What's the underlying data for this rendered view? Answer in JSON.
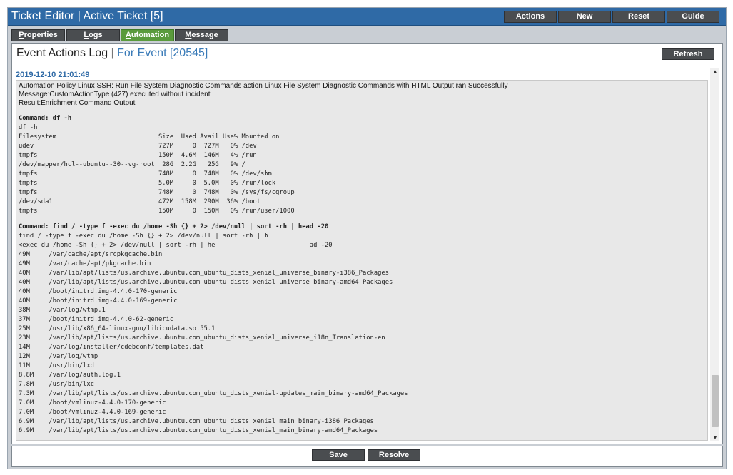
{
  "window": {
    "title": "Ticket Editor | Active Ticket [5]",
    "buttons": [
      "Actions",
      "New",
      "Reset",
      "Guide"
    ]
  },
  "tabs": [
    {
      "label": "Properties",
      "underline": "P",
      "rest": "roperties",
      "active": false
    },
    {
      "label": "Logs",
      "underline": "L",
      "rest": "ogs",
      "active": false
    },
    {
      "label": "Automation",
      "underline": "A",
      "rest": "utomation",
      "active": true
    },
    {
      "label": "Message",
      "underline": "M",
      "rest": "essage",
      "active": false
    }
  ],
  "panel": {
    "title": "Event Actions Log",
    "separator": "|",
    "event_label": "For Event [20545]",
    "refresh_label": "Refresh"
  },
  "log": {
    "timestamp": "2019-12-10 21:01:49",
    "summary": "Automation Policy Linux SSH: Run File System Diagnostic Commands action Linux File System Diagnostic Commands with HTML Output ran Successfully",
    "message": "Message:CustomActionType (427) executed without incident",
    "result_prefix": "Result:",
    "result_link": "Enrichment Command Output",
    "cmd1_header": "Command: df -h",
    "cmd1_echo": "df -h",
    "df_lines": [
      "Filesystem                           Size  Used Avail Use% Mounted on",
      "udev                                 727M     0  727M   0% /dev",
      "tmpfs                                150M  4.6M  146M   4% /run",
      "/dev/mapper/hcl--ubuntu--30--vg-root  28G  2.2G   25G   9% /",
      "tmpfs                                748M     0  748M   0% /dev/shm",
      "tmpfs                                5.0M     0  5.0M   0% /run/lock",
      "tmpfs                                748M     0  748M   0% /sys/fs/cgroup",
      "/dev/sda1                            472M  158M  290M  36% /boot",
      "tmpfs                                150M     0  150M   0% /run/user/1000"
    ],
    "cmd2_header": "Command: find / -type f -exec du /home -Sh {} + 2> /dev/null | sort -rh | head -20",
    "cmd2_echo1": "find / -type f -exec du /home -Sh {} + 2> /dev/null | sort -rh | h",
    "cmd2_echo2": "<exec du /home -Sh {} + 2> /dev/null | sort -rh | he                         ad -20",
    "du_lines": [
      "49M     /var/cache/apt/srcpkgcache.bin",
      "49M     /var/cache/apt/pkgcache.bin",
      "40M     /var/lib/apt/lists/us.archive.ubuntu.com_ubuntu_dists_xenial_universe_binary-i386_Packages",
      "40M     /var/lib/apt/lists/us.archive.ubuntu.com_ubuntu_dists_xenial_universe_binary-amd64_Packages",
      "40M     /boot/initrd.img-4.4.0-170-generic",
      "40M     /boot/initrd.img-4.4.0-169-generic",
      "38M     /var/log/wtmp.1",
      "37M     /boot/initrd.img-4.4.0-62-generic",
      "25M     /usr/lib/x86_64-linux-gnu/libicudata.so.55.1",
      "23M     /var/lib/apt/lists/us.archive.ubuntu.com_ubuntu_dists_xenial_universe_i18n_Translation-en",
      "14M     /var/log/installer/cdebconf/templates.dat",
      "12M     /var/log/wtmp",
      "11M     /usr/bin/lxd",
      "8.8M    /var/log/auth.log.1",
      "7.8M    /usr/bin/lxc",
      "7.3M    /var/lib/apt/lists/us.archive.ubuntu.com_ubuntu_dists_xenial-updates_main_binary-amd64_Packages",
      "7.0M    /boot/vmlinuz-4.4.0-170-generic",
      "7.0M    /boot/vmlinuz-4.4.0-169-generic",
      "6.9M    /var/lib/apt/lists/us.archive.ubuntu.com_ubuntu_dists_xenial_main_binary-i386_Packages",
      "6.9M    /var/lib/apt/lists/us.archive.ubuntu.com_ubuntu_dists_xenial_main_binary-amd64_Packages"
    ]
  },
  "scrollbar": {
    "up_arrow": "▲",
    "down_arrow": "▼"
  },
  "footer": {
    "save_label": "Save",
    "resolve_label": "Resolve"
  },
  "colors": {
    "titlebar": "#2f6aa6",
    "button": "#4a4d50",
    "active_tab": "#5a9b3c",
    "event_link": "#3a7bb8"
  }
}
